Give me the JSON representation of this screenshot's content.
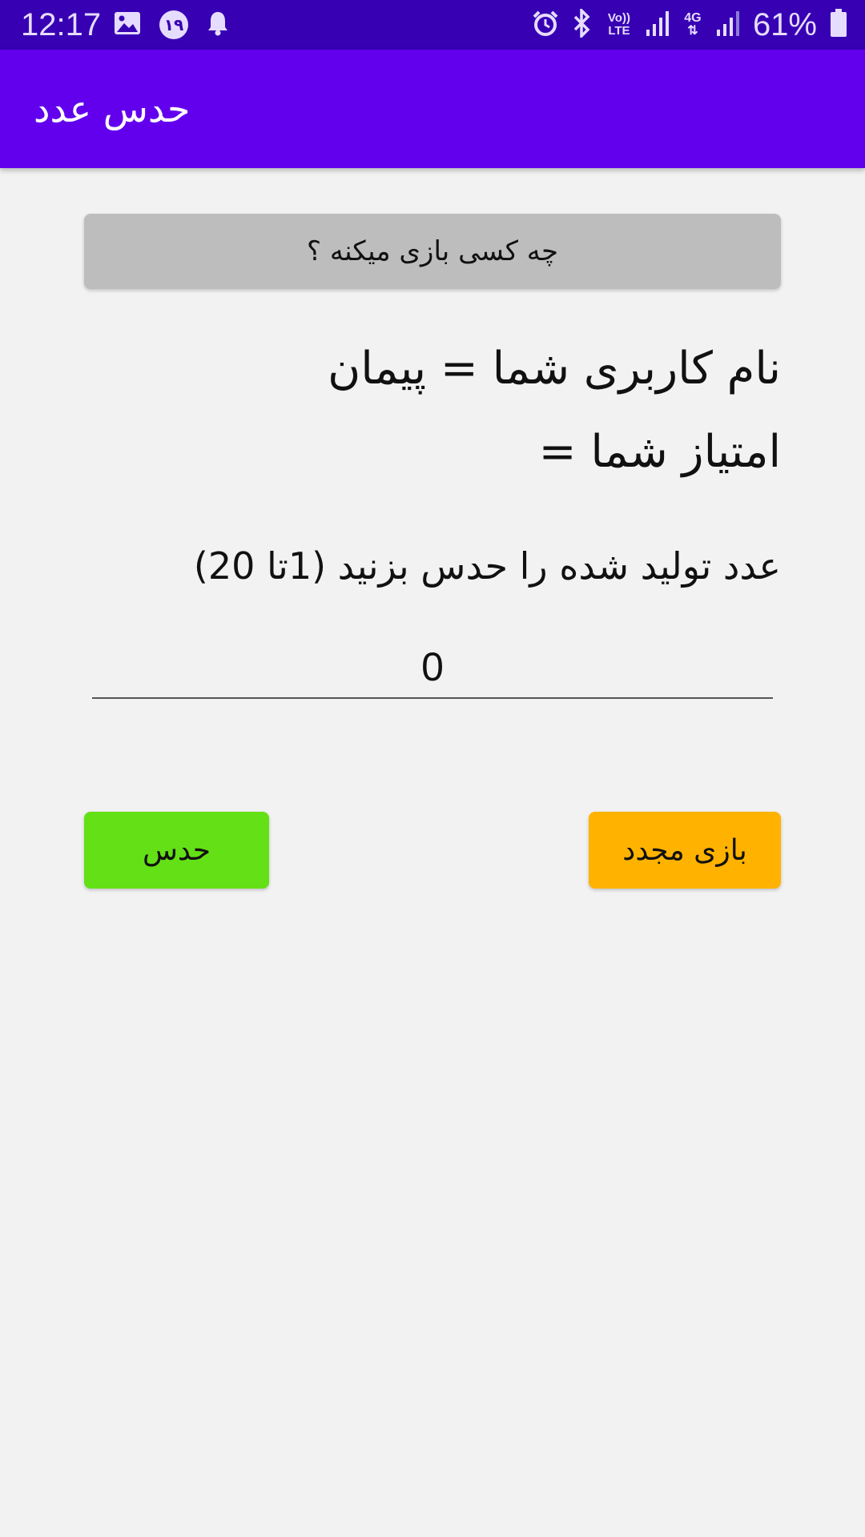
{
  "status_bar": {
    "time": "12:17",
    "notification_badge": "۱۹",
    "network_lte": "Vo)) LTE",
    "network_4g": "4G",
    "battery": "61%",
    "icons": [
      "image-icon",
      "badge-icon",
      "bell-icon",
      "alarm-icon",
      "bluetooth-icon",
      "signal-icon",
      "battery-icon"
    ]
  },
  "app_bar": {
    "title": "حدس عدد",
    "color": "#6200ee"
  },
  "main": {
    "who_button_label": "چه کسی بازی میکنه ؟",
    "username_line": "نام کاربری شما = پیمان",
    "score_line": "امتیاز شما =",
    "prompt": "عدد تولید شده را حدس بزنید (1تا 20)",
    "guess_value": "0"
  },
  "buttons": {
    "guess_label": "حدس",
    "guess_color": "#64e016",
    "restart_label": "بازی مجدد",
    "restart_color": "#ffb300"
  }
}
